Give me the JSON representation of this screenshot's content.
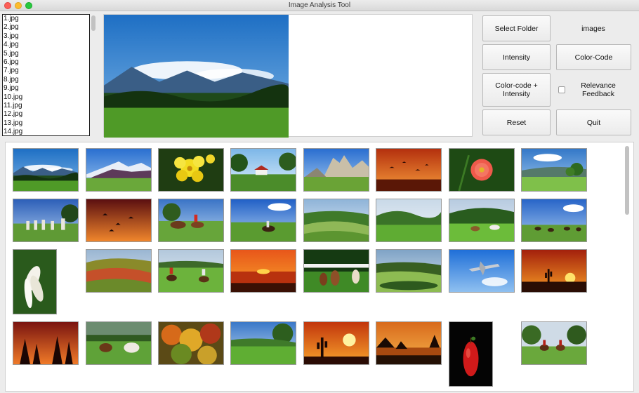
{
  "window": {
    "title": "Image Analysis Tool"
  },
  "file_list": [
    "1.jpg",
    "2.jpg",
    "3.jpg",
    "4.jpg",
    "5.jpg",
    "6.jpg",
    "7.jpg",
    "8.jpg",
    "9.jpg",
    "10.jpg",
    "11.jpg",
    "12.jpg",
    "13.jpg",
    "14.jpg"
  ],
  "controls": {
    "select_folder": "Select Folder",
    "folder_name": "images",
    "intensity": "Intensity",
    "color_code": "Color-Code",
    "color_code_intensity": "Color-code + Intensity",
    "relevance_feedback": "Relevance Feedback",
    "relevance_checked": false,
    "reset": "Reset",
    "quit": "Quit"
  },
  "preview": {
    "scene": "mountain-landscape"
  },
  "thumbnails": [
    {
      "scene": "mountain-landscape"
    },
    {
      "scene": "snowy-mountain-meadow"
    },
    {
      "scene": "yellow-flower"
    },
    {
      "scene": "farmhouse-trees"
    },
    {
      "scene": "rocky-peaks"
    },
    {
      "scene": "orange-sky-birds"
    },
    {
      "scene": "red-flower"
    },
    {
      "scene": "meadow-trees"
    },
    {
      "scene": "stone-statues"
    },
    {
      "scene": "red-sky-birds"
    },
    {
      "scene": "horse-rider"
    },
    {
      "scene": "horse-rider-field"
    },
    {
      "scene": "rolling-fields"
    },
    {
      "scene": "green-hills"
    },
    {
      "scene": "horses-meadow"
    },
    {
      "scene": "horses-field"
    },
    {
      "scene": "white-lily"
    },
    {
      "scene": "autumn-hills"
    },
    {
      "scene": "cowboys"
    },
    {
      "scene": "sunset-lake"
    },
    {
      "scene": "horses-fence"
    },
    {
      "scene": "terraced-field"
    },
    {
      "scene": "airplane"
    },
    {
      "scene": "desert-sunset"
    },
    {
      "scene": "red-sunset-trees"
    },
    {
      "scene": "horses-forest"
    },
    {
      "scene": "autumn-forest"
    },
    {
      "scene": "grassy-hill"
    },
    {
      "scene": "cactus-sunset"
    },
    {
      "scene": "rock-sunset"
    },
    {
      "scene": "red-apple"
    },
    {
      "scene": "horse-riders-trees"
    }
  ]
}
